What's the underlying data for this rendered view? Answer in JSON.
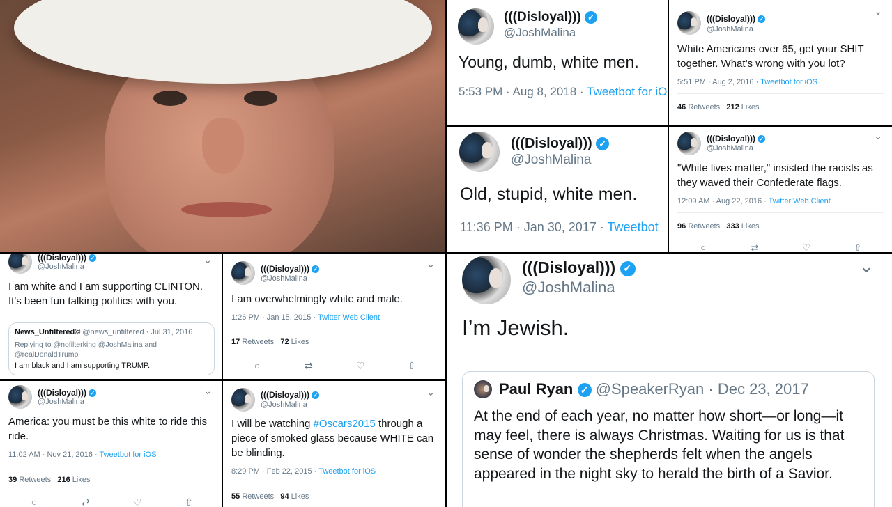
{
  "user": {
    "name": "(((Disloyal)))",
    "handle": "@JoshMalina"
  },
  "colors": {
    "link": "#1da1f2",
    "secondary": "#657786",
    "verified": "#1da1f2"
  },
  "tweets": {
    "t1": {
      "text": "Young, dumb, white men.",
      "time": "5:53 PM",
      "date": "Aug 8, 2018",
      "source": "Tweetbot for iOS"
    },
    "t2": {
      "text": "White Americans over 65, get your SHIT together. What’s wrong with you lot?",
      "time": "5:51 PM",
      "date": "Aug 2, 2016",
      "source": "Tweetbot for iOS",
      "retweets": "46",
      "likes": "212"
    },
    "t3": {
      "text": "Old, stupid, white men.",
      "time": "11:36 PM",
      "date": "Jan 30, 2017",
      "source": "Tweetbot"
    },
    "t4": {
      "text": "\"White lives matter,\" insisted the racists as they waved their Confederate flags.",
      "time": "12:09 AM",
      "date": "Aug 22, 2016",
      "source": "Twitter Web Client",
      "retweets": "96",
      "likes": "333"
    },
    "t5": {
      "text": "I am white and I am supporting CLINTON. It's been fun talking politics with you.",
      "quote": {
        "name": "News_Unfiltered©",
        "handle": "@news_unfiltered",
        "date": "Jul 31, 2016",
        "reply": "Replying to @nofilterking @JoshMalina and @realDonaldTrump",
        "text": "I am black and I am supporting TRUMP."
      }
    },
    "t6": {
      "text": "I am overwhelmingly white and male.",
      "time": "1:26 PM",
      "date": "Jan 15, 2015",
      "source": "Twitter Web Client",
      "retweets": "17",
      "likes": "72"
    },
    "t7": {
      "text": "America: you must be this white to ride this ride.",
      "time": "11:02 AM",
      "date": "Nov 21, 2016",
      "source": "Tweetbot for iOS",
      "retweets": "39",
      "likes": "216"
    },
    "t8": {
      "text_pre": "I will be watching ",
      "hashtag": "#Oscars2015",
      "text_post": " through a piece of smoked glass because WHITE can be blinding.",
      "time": "8:29 PM",
      "date": "Feb 22, 2015",
      "source": "Tweetbot for iOS",
      "retweets": "55",
      "likes": "94"
    },
    "t9": {
      "text": "I’m Jewish.",
      "quote": {
        "name": "Paul Ryan",
        "handle": "@SpeakerRyan",
        "date": "Dec 23, 2017",
        "text": "At the end of each year, no matter how short—or long—it may feel, there is always Christmas. Waiting for us is that sense of wonder the shepherds felt when the angels appeared in the night sky to herald the birth of a Savior."
      }
    }
  },
  "labels": {
    "retweets": "Retweets",
    "likes": "Likes",
    "sep": "·",
    "check": "✓",
    "chevron": "⌄"
  },
  "icons": {
    "reply": "○",
    "retweet": "⇄",
    "like": "♡",
    "share": "⇧"
  }
}
